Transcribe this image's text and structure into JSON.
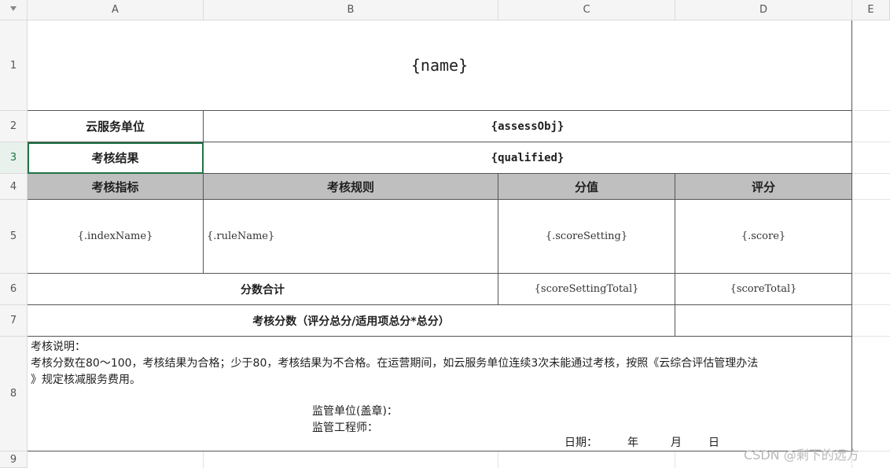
{
  "columns": [
    "A",
    "B",
    "C",
    "D",
    "E"
  ],
  "rows": [
    "1",
    "2",
    "3",
    "4",
    "5",
    "6",
    "7",
    "8",
    "9"
  ],
  "title": "{name}",
  "row2": {
    "label": "云服务单位",
    "value": "{assessObj}"
  },
  "row3": {
    "label": "考核结果",
    "value": "{qualified}"
  },
  "header": {
    "index": "考核指标",
    "rule": "考核规则",
    "setting": "分值",
    "score": "评分"
  },
  "row5": {
    "index": "{.indexName}",
    "rule": "{.ruleName}",
    "setting": "{.scoreSetting}",
    "score": "{.score}"
  },
  "row6": {
    "label": "分数合计",
    "setting_total": "{scoreSettingTotal}",
    "score_total": "{scoreTotal}"
  },
  "row7": {
    "label": "考核分数（评分总分/适用项总分*总分）"
  },
  "notes": {
    "line1": "考核说明：",
    "line2": "考核分数在80～100，考核结果为合格；少于80，考核结果为不合格。在运营期间，如云服务单位连续3次未能通过考核，按照《云综合评估管理办法",
    "line3": "》规定核减服务费用。",
    "supervisor_unit": "监管单位(盖章)：",
    "supervisor_engineer": "监管工程师：",
    "date": "日期：",
    "year": "年",
    "month": "月",
    "day": "日"
  },
  "watermark": "CSDN @剩下的远方"
}
